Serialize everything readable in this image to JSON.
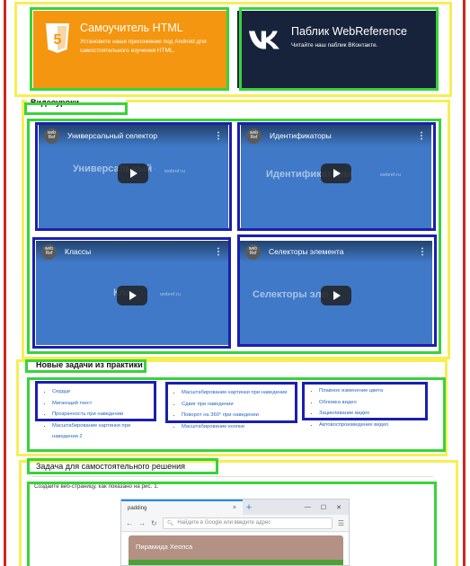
{
  "promo": {
    "html_title": "Самоучитель HTML",
    "html_desc": "Установите наше приложение под Android для самостоятельного изучения HTML.",
    "html_icon_text": "5",
    "vk_title": "Паблик WebReference",
    "vk_desc": "Читайте наш паблик ВКонтакте.",
    "vk_icon": "vk-logo-icon"
  },
  "sections": {
    "videos": "Видеоуроки",
    "tasks": "Новые задачи из практики",
    "self": "Задача для самостоятельного решения"
  },
  "videos": [
    {
      "title": "Универсальный селектор",
      "bg": "Универсальный селектор",
      "site": "webref.ru",
      "avatar": "web Ref"
    },
    {
      "title": "Идентификаторы",
      "bg": "Идентификаторы",
      "site": "webref.ru",
      "avatar": "web Ref"
    },
    {
      "title": "Классы",
      "bg": "Классы",
      "site": "webref.ru",
      "avatar": "web Ref"
    },
    {
      "title": "Селекторы элемента",
      "bg": "Селекторы элемента",
      "site": "webref.ru",
      "avatar": "web Ref"
    }
  ],
  "tasks": {
    "col1": [
      "Сердце",
      "Мигающий текст",
      "Прозрачность при наведении",
      "Масштабирование картинки при наведении 2"
    ],
    "col2": [
      "Масштабирование картинки при наведении",
      "Сдвиг при наведении",
      "Поворот на 360° при наведении",
      "Масштабирование кнопки"
    ],
    "col3": [
      "Плавное изменение цвета",
      "Обложка видео",
      "Зацикливание видео",
      "Автовоспроизведение видео"
    ]
  },
  "self_task": {
    "text": "Создайте веб-страницу, как показано на рис. 1.",
    "browser": {
      "tab_label": "padding",
      "tab_close": "×",
      "new_tab": "+",
      "min": "—",
      "max": "☐",
      "close": "✕",
      "address_placeholder": "Найдите в Google или введите адрес",
      "content_title": "Пирамида Хеопса"
    }
  },
  "colors": {
    "html_tile": "#f4960f",
    "vk_tile": "#17233a",
    "video_bg": "#3f79c7",
    "link": "#2a66c2",
    "outline_yellow": "#f4f052",
    "outline_green": "#39d33b",
    "outline_blue": "#1b1fae",
    "outline_red": "#d0261c"
  }
}
